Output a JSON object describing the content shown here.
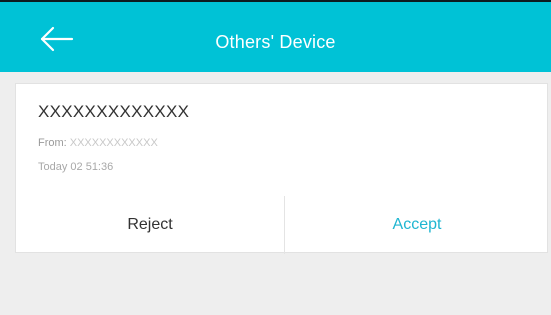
{
  "header": {
    "title": "Others' Device",
    "back_icon": "arrow-left-icon",
    "background_color": "#00c2d6"
  },
  "request": {
    "device_name": "XXXXXXXXXXXXX",
    "from_label": "From:",
    "from_value": "XXXXXXXXXXXX",
    "timestamp": "Today 02 51:36"
  },
  "actions": {
    "reject_label": "Reject",
    "accept_label": "Accept",
    "accept_color": "#1fb6d1"
  }
}
